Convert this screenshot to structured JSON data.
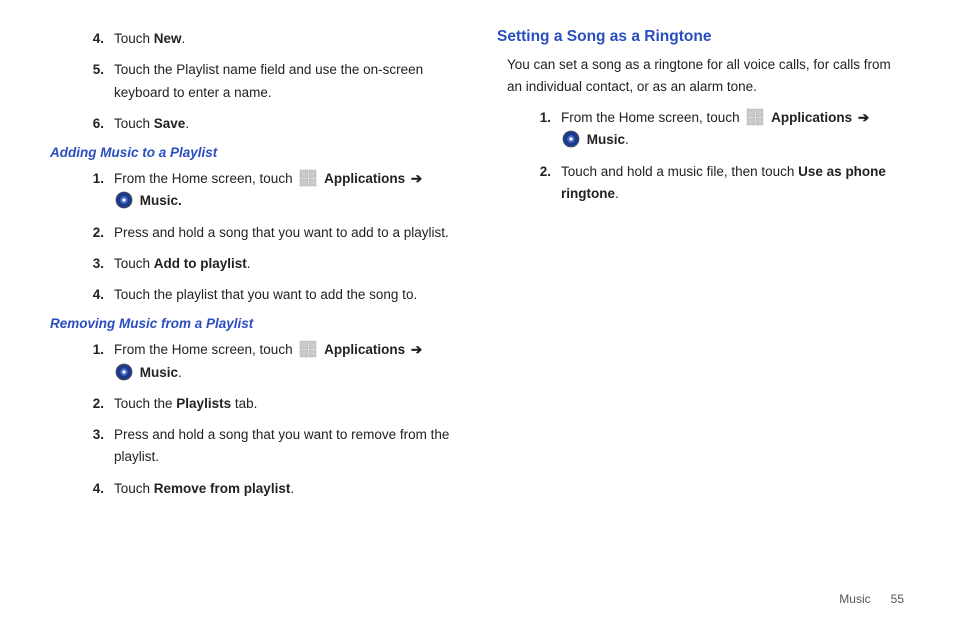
{
  "left": {
    "steps_top": [
      {
        "n": "4.",
        "pre": "Touch ",
        "bold": "New",
        "post": "."
      },
      {
        "n": "5.",
        "pre": "Touch the Playlist name field and use the on-screen keyboard to enter a name.",
        "bold": "",
        "post": ""
      },
      {
        "n": "6.",
        "pre": "Touch ",
        "bold": "Save",
        "post": "."
      }
    ],
    "h_add": "Adding Music to a Playlist",
    "add_step1_pre": "From the Home screen, touch ",
    "add_step1_apps": "Applications",
    "add_step1_music": "Music.",
    "add_steps_rest": [
      {
        "n": "2.",
        "pre": "Press and hold a song that you want to add to a playlist.",
        "bold": "",
        "post": ""
      },
      {
        "n": "3.",
        "pre": "Touch ",
        "bold": "Add to playlist",
        "post": "."
      },
      {
        "n": "4.",
        "pre": "Touch the playlist that you want to add the song to.",
        "bold": "",
        "post": ""
      }
    ],
    "h_remove": "Removing Music from a Playlist",
    "rem_step1_pre": "From the Home screen, touch ",
    "rem_step1_apps": "Applications",
    "rem_step1_music": "Music",
    "rem_steps_rest": [
      {
        "n": "2.",
        "pre": "Touch the ",
        "bold": "Playlists",
        "post": " tab."
      },
      {
        "n": "3.",
        "pre": "Press and hold a song that you want to remove from the playlist.",
        "bold": "",
        "post": ""
      },
      {
        "n": "4.",
        "pre": "Touch ",
        "bold": "Remove from playlist",
        "post": "."
      }
    ]
  },
  "right": {
    "h_ring": "Setting a Song as a Ringtone",
    "intro": "You can set a song as a ringtone for all voice calls, for calls from an individual contact, or as an alarm tone.",
    "ring_step1_pre": "From the Home screen, touch ",
    "ring_step1_apps": "Applications",
    "ring_step1_music": "Music",
    "ring_step2_pre": "Touch and hold a music file, then touch ",
    "ring_step2_bold": "Use as phone ringtone",
    "ring_step2_post": "."
  },
  "footer": {
    "section": "Music",
    "page": "55"
  },
  "nums": {
    "one": "1.",
    "two": "2."
  }
}
